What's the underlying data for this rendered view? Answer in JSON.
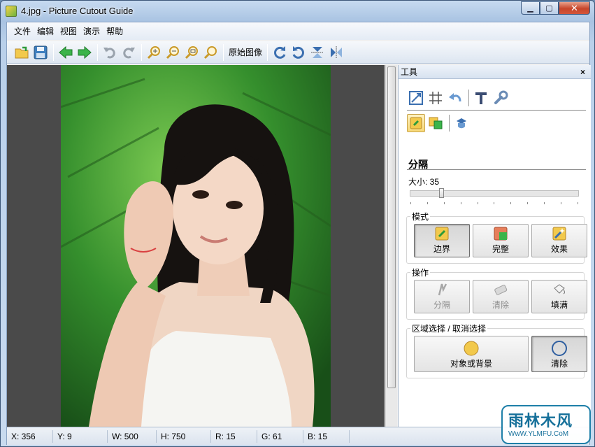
{
  "window": {
    "title": "4.jpg - Picture Cutout Guide",
    "controls": [
      "minimize",
      "maximize",
      "close"
    ]
  },
  "menu": [
    "文件",
    "编辑",
    "视图",
    "演示",
    "帮助"
  ],
  "toolbar": {
    "items": [
      "open-icon",
      "save-icon",
      "back-arrow-icon",
      "forward-arrow-icon",
      "undo-icon",
      "redo-icon",
      "zoom-in-icon",
      "zoom-out-icon",
      "zoom-fit-icon",
      "zoom-actual-icon"
    ],
    "original_label": "原始图像",
    "transform_items": [
      "rotate-right-icon",
      "rotate-left-icon",
      "flip-vertical-icon",
      "flip-horizontal-icon"
    ]
  },
  "panel": {
    "title": "工具",
    "close": "×",
    "top_icons": [
      "resize-icon",
      "crop-grid-icon",
      "undo-arrow-icon",
      "text-icon",
      "wrench-icon"
    ],
    "mode_icons": [
      "separate-tool-icon",
      "merge-tool-icon",
      "dispatch-tool-icon"
    ],
    "section_title": "分隔",
    "size_label": "大小: 35",
    "size_value": 35,
    "size_max": 100,
    "mode_group": {
      "title": "模式",
      "buttons": [
        {
          "label": "边界",
          "pressed": true
        },
        {
          "label": "完整",
          "pressed": false
        },
        {
          "label": "效果",
          "pressed": false
        }
      ]
    },
    "operation_group": {
      "title": "操作",
      "buttons": [
        {
          "label": "分隔",
          "enabled": false
        },
        {
          "label": "清除",
          "enabled": false
        },
        {
          "label": "填满",
          "enabled": true
        }
      ]
    },
    "region_group": {
      "title": "区域选择 / 取消选择",
      "buttons": [
        {
          "label": "对象或背景",
          "pressed": false
        },
        {
          "label": "清除",
          "pressed": true
        }
      ]
    }
  },
  "status": {
    "x": "X: 356",
    "y": "Y: 9",
    "w": "W: 500",
    "h": "H: 750",
    "r": "R: 15",
    "g": "G: 61",
    "b": "B: 15"
  },
  "watermark": {
    "top": "雨林木风",
    "bottom": "WwW.YLMFU.CoM"
  }
}
